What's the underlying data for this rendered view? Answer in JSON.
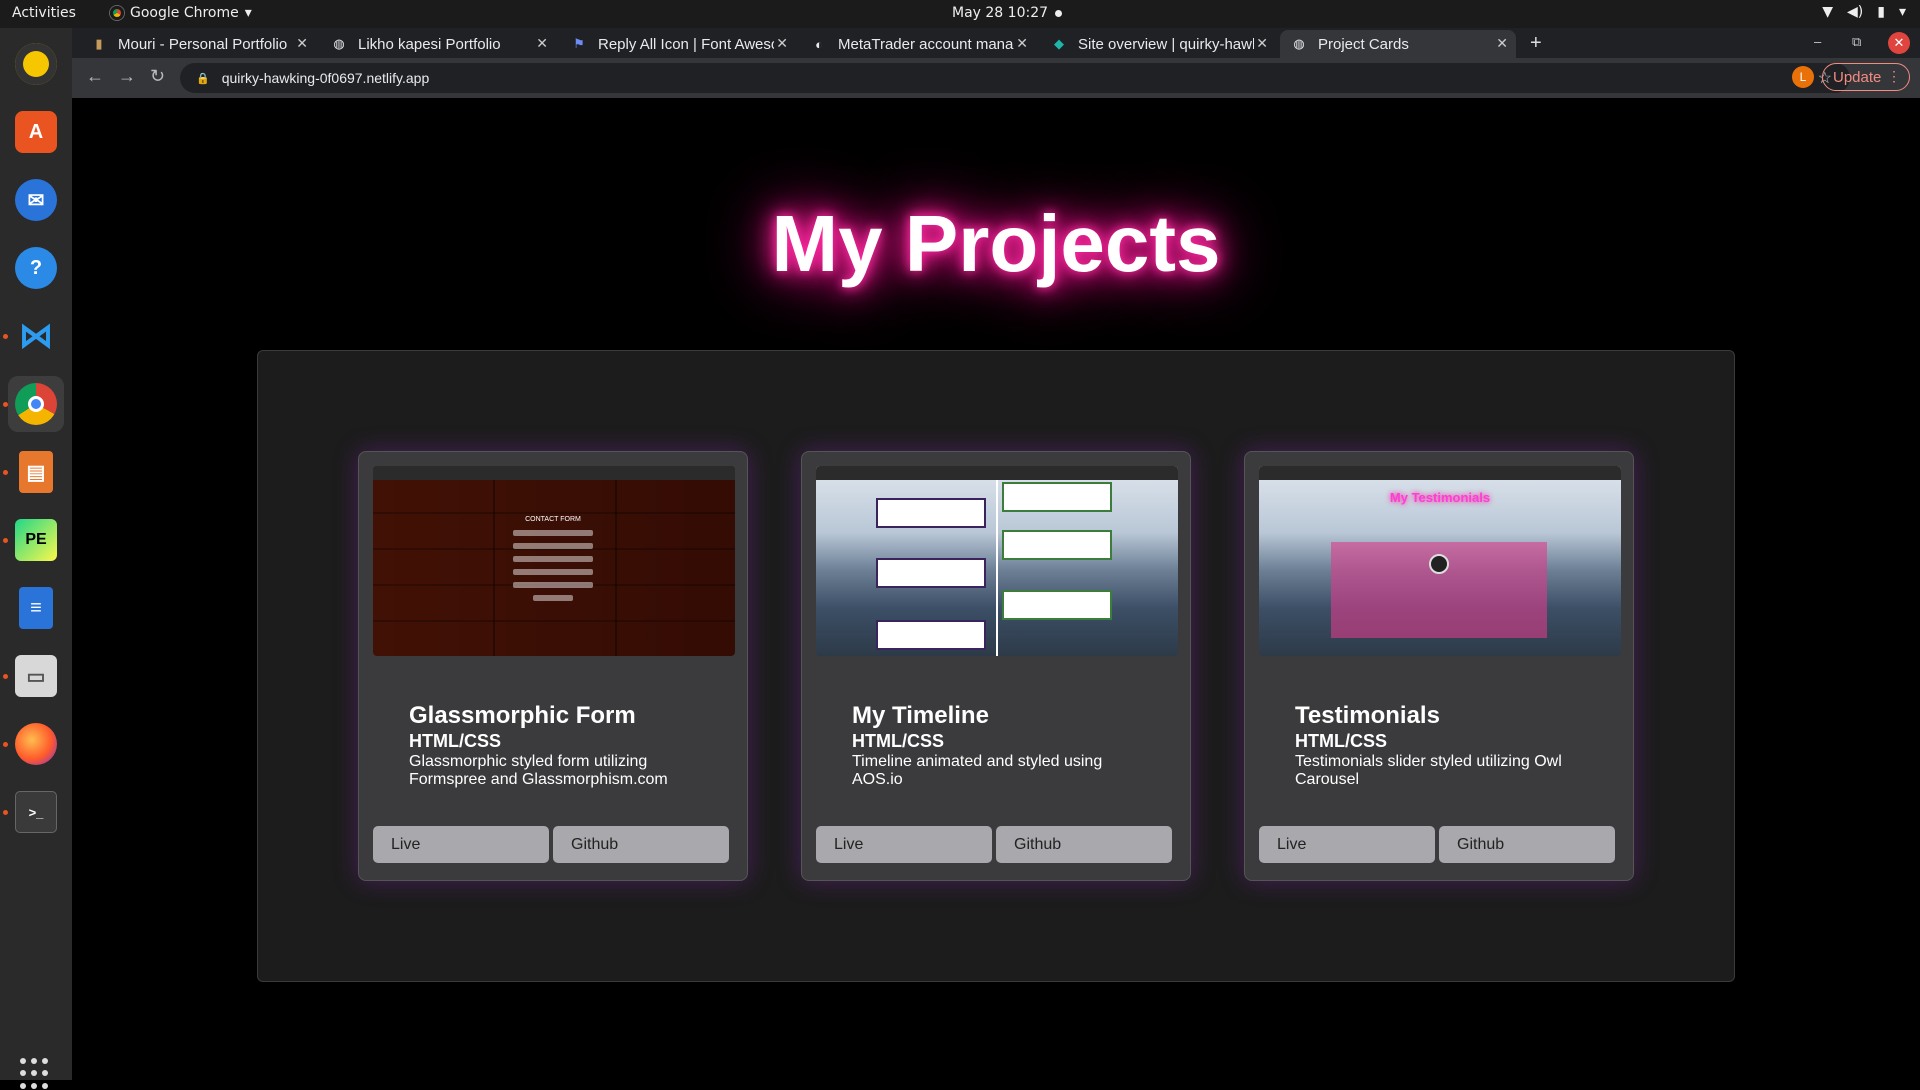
{
  "system": {
    "activities": "Activities",
    "app_name": "Google Chrome",
    "clock": "May 28  10:27"
  },
  "dock": {
    "items": [
      "rhythmbox-icon",
      "software-icon",
      "thunderbird-icon",
      "help-icon",
      "vscode-icon",
      "chrome-icon",
      "impress-icon",
      "pycharm-icon",
      "writer-icon",
      "files-icon",
      "firefox-icon",
      "terminal-icon"
    ]
  },
  "browser": {
    "tabs": [
      {
        "title": "Mouri - Personal Portfolio",
        "icon": "mouri-icon"
      },
      {
        "title": "Likho kapesi Portfolio",
        "icon": "globe-icon"
      },
      {
        "title": "Reply All Icon | Font Awesome",
        "icon": "flag-icon"
      },
      {
        "title": "MetaTrader account manager",
        "icon": "metatrader-icon"
      },
      {
        "title": "Site overview | quirky-hawking",
        "icon": "netlify-icon"
      },
      {
        "title": "Project Cards",
        "icon": "globe-icon"
      }
    ],
    "active_tab": 5,
    "url": "quirky-hawking-0f0697.netlify.app",
    "profile_initial": "L",
    "update_label": "Update"
  },
  "page": {
    "title": "My Projects",
    "cards": [
      {
        "title": "Glassmorphic Form",
        "tech": "HTML/CSS",
        "description": "Glassmorphic styled form utilizing Formspree and Glassmorphism.com",
        "live_label": "Live",
        "github_label": "Github",
        "thumb_text": "CONTACT FORM"
      },
      {
        "title": "My Timeline",
        "tech": "HTML/CSS",
        "description": "Timeline animated and styled using AOS.io",
        "live_label": "Live",
        "github_label": "Github"
      },
      {
        "title": "Testimonials",
        "tech": "HTML/CSS",
        "description": "Testimonials slider styled utilizing Owl Carousel",
        "live_label": "Live",
        "github_label": "Github",
        "thumb_text": "My Testimonials"
      }
    ]
  },
  "colors": {
    "glow": "#ff1493",
    "card_bg": "#3b3b3d",
    "button_bg": "#a9a9ad"
  }
}
